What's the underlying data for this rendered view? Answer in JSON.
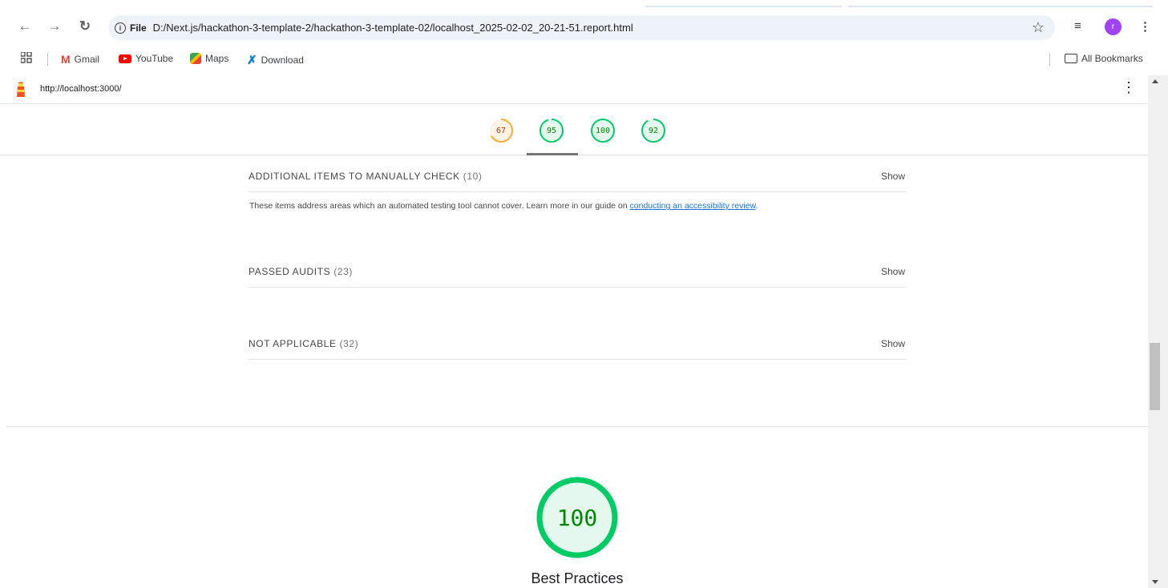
{
  "browser": {
    "omnibox_scheme_label": "File",
    "url": "D:/Next.js/hackathon-3-template-2/hackathon-3-template-02/localhost_2025-02-02_20-21-51.report.html",
    "profile_initial": "r"
  },
  "bookmarks": {
    "items": [
      {
        "label": "Gmail",
        "icon": "gmail-icon"
      },
      {
        "label": "YouTube",
        "icon": "youtube-icon"
      },
      {
        "label": "Maps",
        "icon": "maps-icon"
      },
      {
        "label": "Download",
        "icon": "vscode-icon"
      }
    ],
    "all_bookmarks_label": "All Bookmarks"
  },
  "report": {
    "url": "http://localhost:3000/",
    "scores": [
      {
        "value": "67",
        "score": 0.67,
        "color": "#fa3"
      },
      {
        "value": "95",
        "score": 0.95,
        "color": "#0c6"
      },
      {
        "value": "100",
        "score": 1.0,
        "color": "#0c6"
      },
      {
        "value": "92",
        "score": 0.92,
        "color": "#0c6"
      }
    ],
    "groups": [
      {
        "title": "ADDITIONAL ITEMS TO MANUALLY CHECK",
        "count": "(10)",
        "action": "Show"
      },
      {
        "title": "PASSED AUDITS",
        "count": "(23)",
        "action": "Show"
      },
      {
        "title": "NOT APPLICABLE",
        "count": "(32)",
        "action": "Show"
      }
    ],
    "manual_description": "These items address areas which an automated testing tool cannot cover. Learn more in our guide on ",
    "manual_link": "conducting an accessibility review",
    "manual_period": ".",
    "category": {
      "score": "100",
      "score_fraction": 1.0,
      "label": "Best Practices",
      "color": "#0c6"
    }
  },
  "colors": {
    "pass": "#0c6",
    "average": "#fa3",
    "link": "#1a73e8"
  }
}
